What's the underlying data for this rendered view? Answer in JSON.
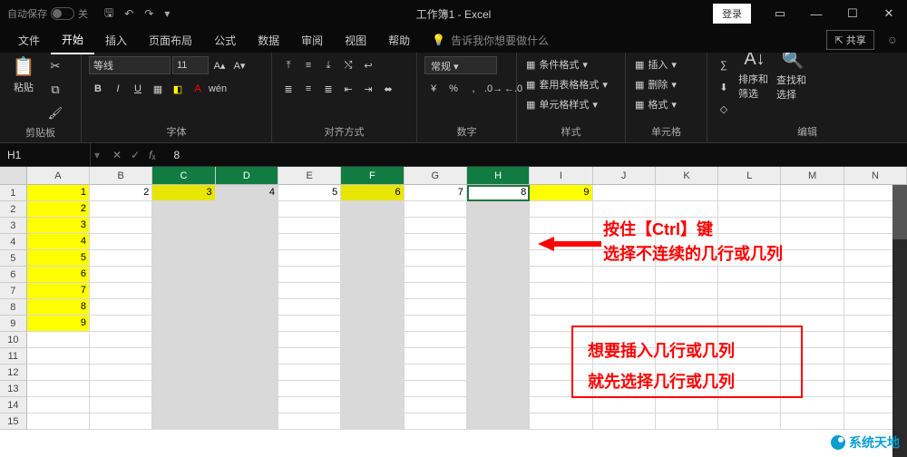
{
  "titlebar": {
    "autosave_label": "自动保存",
    "autosave_off": "关",
    "title": "工作簿1 - Excel",
    "login": "登录"
  },
  "tabs": {
    "file": "文件",
    "home": "开始",
    "insert": "插入",
    "layout": "页面布局",
    "formulas": "公式",
    "data": "数据",
    "review": "审阅",
    "view": "视图",
    "help": "帮助",
    "tell_me": "告诉我你想要做什么"
  },
  "share": "共享",
  "ribbon": {
    "clipboard": {
      "paste": "粘贴",
      "label": "剪贴板"
    },
    "font": {
      "name": "等线",
      "size": "11",
      "label": "字体"
    },
    "align": {
      "label": "对齐方式"
    },
    "number": {
      "format": "常规",
      "label": "数字"
    },
    "styles": {
      "cond": "条件格式",
      "table": "套用表格格式",
      "cell": "单元格样式",
      "label": "样式"
    },
    "cells": {
      "insert": "插入",
      "delete": "删除",
      "format": "格式",
      "label": "单元格"
    },
    "editing": {
      "sort": "排序和筛选",
      "find": "查找和选择",
      "label": "编辑"
    }
  },
  "formula_bar": {
    "name_box": "H1",
    "value": "8"
  },
  "grid": {
    "columns": [
      "A",
      "B",
      "C",
      "D",
      "E",
      "F",
      "G",
      "H",
      "I",
      "J",
      "K",
      "L",
      "M",
      "N"
    ],
    "selected_cols": [
      "C",
      "D",
      "F",
      "H"
    ],
    "row_count": 15,
    "selected_rows": [],
    "row1": [
      "1",
      "2",
      "3",
      "4",
      "5",
      "6",
      "7",
      "8",
      "9",
      "",
      "",
      "",
      "",
      ""
    ],
    "col_a": [
      "1",
      "2",
      "3",
      "4",
      "5",
      "6",
      "7",
      "8",
      "9",
      "",
      "",
      "",
      "",
      "",
      ""
    ]
  },
  "annotations": {
    "line1": "按住【Ctrl】键",
    "line2": "选择不连续的几行或几列",
    "box1": "想要插入几行或几列",
    "box2": "就先选择几行或几列"
  },
  "watermark": "系统天地"
}
